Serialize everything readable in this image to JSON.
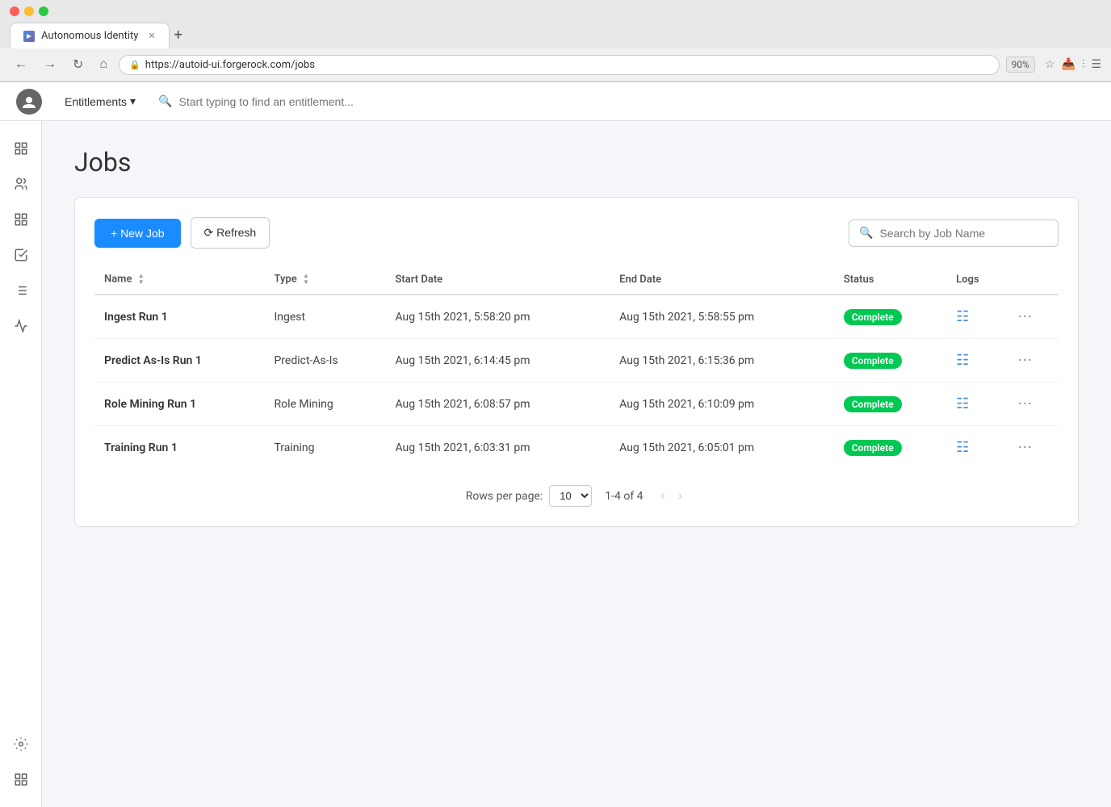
{
  "browser": {
    "tab_title": "Autonomous Identity",
    "url": "https://autoid-ui.forgerock.com/jobs",
    "zoom": "90%",
    "add_tab": "+",
    "nav": {
      "back": "←",
      "forward": "→",
      "reload": "↻",
      "home": "⌂"
    }
  },
  "topnav": {
    "entitlements_label": "Entitlements",
    "search_placeholder": "Start typing to find an entitlement..."
  },
  "page": {
    "title": "Jobs"
  },
  "toolbar": {
    "new_job_label": "+ New Job",
    "refresh_label": "⟳ Refresh",
    "search_placeholder": "Search by Job Name"
  },
  "table": {
    "columns": [
      "Name",
      "Type",
      "Start Date",
      "End Date",
      "Status",
      "Logs"
    ],
    "rows": [
      {
        "name": "Ingest Run 1",
        "type": "Ingest",
        "start_date": "Aug 15th 2021, 5:58:20 pm",
        "end_date": "Aug 15th 2021, 5:58:55 pm",
        "status": "Complete"
      },
      {
        "name": "Predict As-Is Run 1",
        "type": "Predict-As-Is",
        "start_date": "Aug 15th 2021, 6:14:45 pm",
        "end_date": "Aug 15th 2021, 6:15:36 pm",
        "status": "Complete"
      },
      {
        "name": "Role Mining Run 1",
        "type": "Role Mining",
        "start_date": "Aug 15th 2021, 6:08:57 pm",
        "end_date": "Aug 15th 2021, 6:10:09 pm",
        "status": "Complete"
      },
      {
        "name": "Training Run 1",
        "type": "Training",
        "start_date": "Aug 15th 2021, 6:03:31 pm",
        "end_date": "Aug 15th 2021, 6:05:01 pm",
        "status": "Complete"
      }
    ]
  },
  "pagination": {
    "rows_per_page_label": "Rows per page:",
    "rows_per_page_value": "10",
    "page_info": "1-4 of 4"
  },
  "colors": {
    "accent_blue": "#1a8cff",
    "status_complete": "#00c853"
  }
}
